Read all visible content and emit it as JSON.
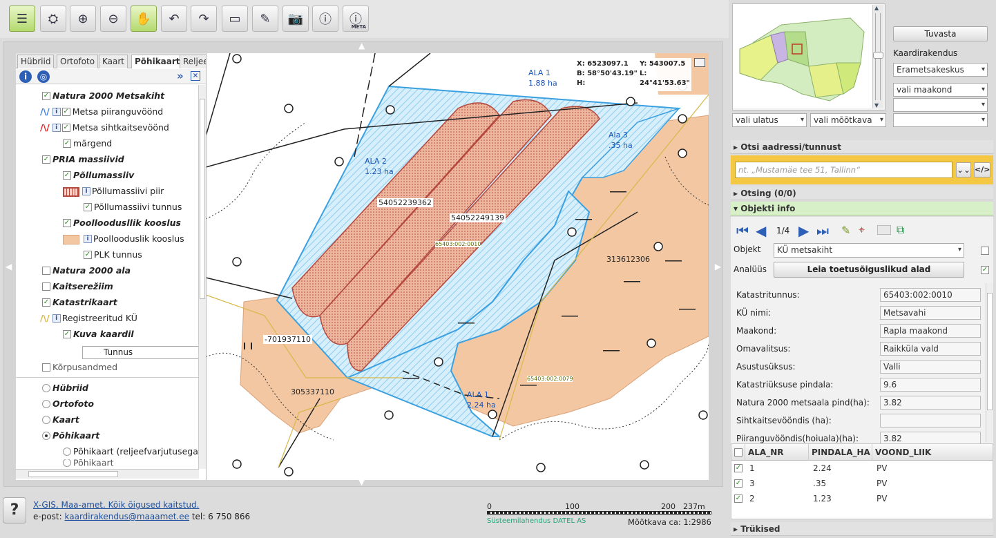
{
  "layer_tabs": [
    "Hübriid",
    "Ortofoto",
    "Kaart",
    "Põhikaart",
    "Reljeef"
  ],
  "layers": [
    {
      "label": "Natura 2000 Metsakiht",
      "checked": true,
      "group": true
    },
    {
      "label": "Metsa piiranguvöönd",
      "checked": true
    },
    {
      "label": "Metsa sihtkaitsevöönd",
      "checked": true
    },
    {
      "label": "märgend",
      "checked": true
    },
    {
      "label": "PRIA massiivid",
      "checked": true,
      "group": true
    },
    {
      "label": "Põllumassiiv",
      "checked": true,
      "group": true
    },
    {
      "label": "Põllumassiivi piir"
    },
    {
      "label": "Põllumassiivi tunnus",
      "checked": true
    },
    {
      "label": "Poolloodusllik kooslus",
      "checked": true,
      "group": true
    },
    {
      "label": "Poollooduslik kooslus"
    },
    {
      "label": "PLK tunnus",
      "checked": true
    },
    {
      "label": "Natura 2000 ala",
      "checked": false,
      "group": true
    },
    {
      "label": "Kaitserežiim",
      "checked": false,
      "group": true
    },
    {
      "label": "Katastrikaart",
      "checked": true,
      "group": true
    },
    {
      "label": "Registreeritud KÜ",
      "checked": true
    },
    {
      "label": "Kuva kaardil",
      "checked": true,
      "group": true
    },
    {
      "label": "Kõrpusandmed",
      "checked": false
    }
  ],
  "layer_select_value": "Tunnus",
  "base_maps": [
    {
      "label": "Hübriid",
      "selected": false
    },
    {
      "label": "Ortofoto",
      "selected": false
    },
    {
      "label": "Kaart",
      "selected": false
    },
    {
      "label": "Põhikaart",
      "selected": true
    },
    {
      "label": "Põhikaart (reljeefvarjutusega",
      "selected": false
    },
    {
      "label": "Põhikaart",
      "selected": false
    }
  ],
  "coords": {
    "x": "X: 6523097.1",
    "y": "Y: 543007.5",
    "b": "B: 58°50'43.19\"",
    "l": "L: 24°41'53.63\"",
    "h": "H:"
  },
  "map_labels": {
    "ala1_top": "ALA 1",
    "ala1_top_area": "1.88 ha",
    "ala2": "ALA 2",
    "ala2_area": "1.23 ha",
    "ala3": "Ala 3",
    "ala3_area": ".35 ha",
    "ala1_bottom": "ALA 1",
    "ala1_bottom_area": "2.24 ha",
    "parcel1": "54052239362",
    "parcel2": "54052249139",
    "parcel3": "313612306",
    "parcel4": "-701937110",
    "parcel5": "305337110",
    "cad1": "65403:002:0010",
    "cad2": "65403:002:0079"
  },
  "footer": {
    "link": "X-GIS, Maa-amet. Kõik õigused kaitstud.",
    "email_prefix": "e-post:",
    "email": "kaardirakendus@maaamet.ee",
    "phone": "tel: 6 750 866",
    "system": "Süsteemilahendus DATEL AS",
    "scale_ticks": [
      "0",
      "100",
      "200",
      "237m"
    ],
    "scale_text": "Mõõtkava ca: 1:2986"
  },
  "right": {
    "tuvasta": "Tuvasta",
    "app_label": "Kaardirakendus",
    "app_value": "Erametsakeskus",
    "county": "vali maakond",
    "extent": "vali ulatus",
    "scale": "vali mõõtkava",
    "search_header": "Otsi aadressi/tunnust",
    "search_placeholder": "nt. „Mustamäe tee 51, Tallinn“",
    "otsing_header": "Otsing (0/0)",
    "info_header": "Objekti info",
    "pager": "1/4",
    "object_label": "Objekt",
    "object_value": "KÜ metsakiht",
    "analysis_label": "Analüüs",
    "analysis_button": "Leia toetusõiguslikud alad",
    "print_header": "Trükised"
  },
  "fields": [
    {
      "label": "Katastritunnus:",
      "value": "65403:002:0010"
    },
    {
      "label": "KÜ nimi:",
      "value": "Metsavahi"
    },
    {
      "label": "Maakond:",
      "value": "Rapla maakond"
    },
    {
      "label": "Omavalitsus:",
      "value": "Raikküla vald"
    },
    {
      "label": "Asustusüksus:",
      "value": "Valli"
    },
    {
      "label": "Katastriüksuse pindala:",
      "value": "9.6"
    },
    {
      "label": "Natura 2000 metsaala pind(ha):",
      "value": "3.82"
    },
    {
      "label": "Sihtkaitsevööndis (ha):",
      "value": ""
    },
    {
      "label": "Piiranguvööndis(hoiuala)(ha):",
      "value": "3.82"
    }
  ],
  "table": {
    "columns": [
      "ALA_NR",
      "PINDALA_HA",
      "VOOND_LIIK"
    ],
    "rows": [
      [
        "1",
        "2.24",
        "PV"
      ],
      [
        "3",
        ".35",
        "PV"
      ],
      [
        "2",
        "1.23",
        "PV"
      ]
    ]
  },
  "colors": {
    "natura_blue": "#3aa0e0",
    "plk_orange": "#f2c7a2",
    "field_brown": "#b5483c",
    "active_green": "#b3d96e"
  }
}
